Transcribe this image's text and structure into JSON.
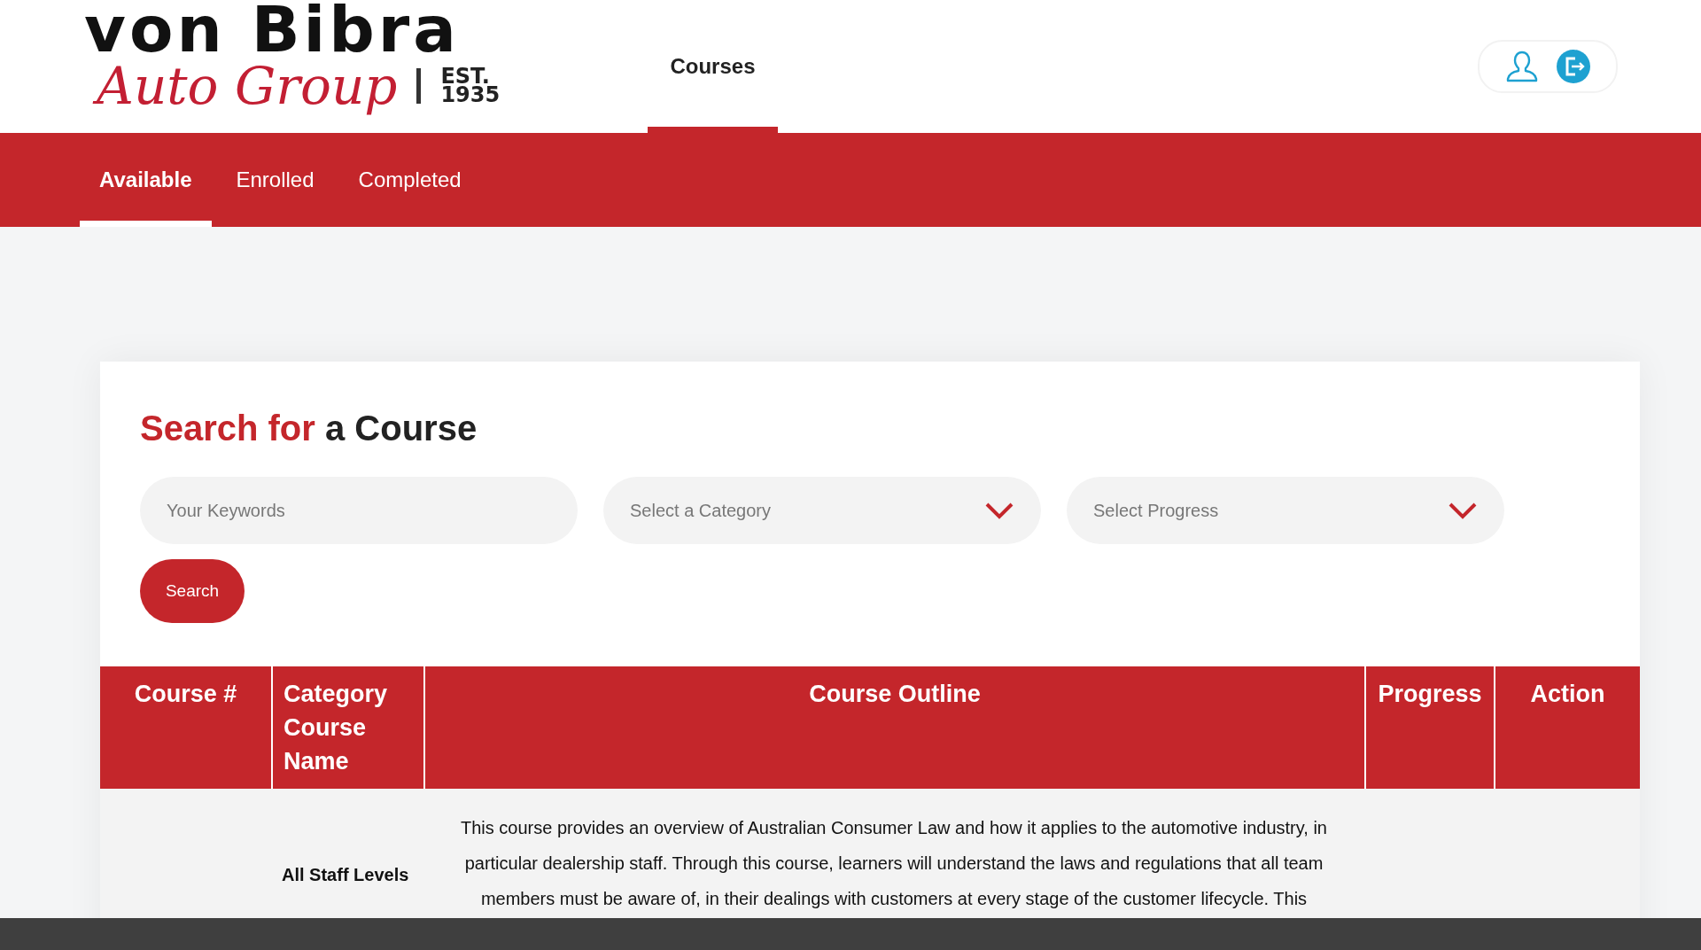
{
  "header": {
    "logo": {
      "line1": "von Bibra",
      "line2": "Auto Group",
      "est_label": "EST.",
      "est_year": "1935"
    },
    "nav": [
      {
        "label": "Courses",
        "selected": true
      }
    ]
  },
  "tabs": [
    {
      "label": "Available",
      "selected": true
    },
    {
      "label": "Enrolled",
      "selected": false
    },
    {
      "label": "Completed",
      "selected": false
    }
  ],
  "search": {
    "title_accent": "Search for",
    "title_rest": "a Course",
    "fields": [
      {
        "kind": "text",
        "placeholder": "Your Keywords"
      },
      {
        "kind": "select",
        "placeholder": "Select a Category"
      },
      {
        "kind": "select",
        "placeholder": "Select Progress"
      }
    ],
    "button": "Search"
  },
  "table": {
    "columns": [
      "Course #",
      "Category Course Name",
      "Course Outline",
      "Progress",
      "Action"
    ],
    "rows": [
      {
        "category": "All Staff Levels",
        "outline": "This course provides an overview of Australian Consumer Law and how it applies to the automotive industry, in particular dealership staff. Through this course, learners will understand the laws and regulations that all team members must be aware of, in their dealings with customers at every stage of the customer lifecycle. This"
      }
    ]
  }
}
